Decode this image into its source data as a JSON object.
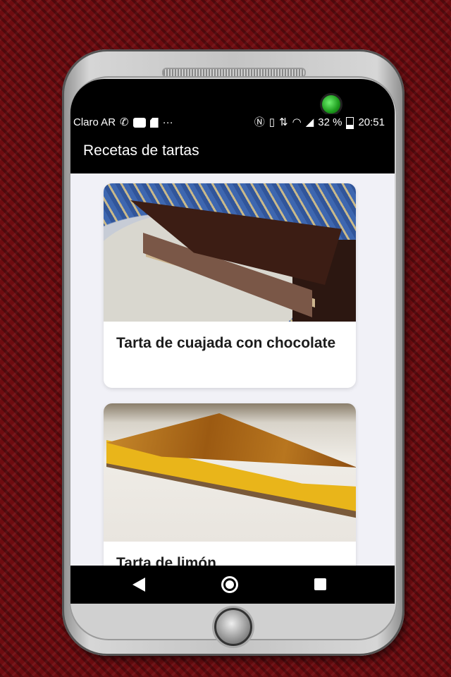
{
  "status_bar": {
    "carrier": "Claro AR",
    "dots": "···",
    "battery": "32 %",
    "time": "20:51",
    "icons": [
      "whatsapp-icon",
      "notification-square-icon",
      "sd-card-icon",
      "nfc-icon",
      "vibrate-icon",
      "data-arrows-icon",
      "wifi-icon",
      "signal-icon",
      "battery-icon"
    ]
  },
  "app_bar": {
    "title": "Recetas de tartas"
  },
  "recipes": [
    {
      "title": "Tarta de cuajada con chocolate",
      "image": "chocolate-cheesecake-photo"
    },
    {
      "title": "Tarta de limón",
      "image": "lemon-tart-photo"
    }
  ],
  "nav_bar": {
    "icons": [
      "back-icon",
      "home-icon",
      "recents-icon"
    ]
  },
  "colors": {
    "background": "#6e0c10",
    "app_bar": "#000000",
    "content_bg": "#f1f1f7",
    "card": "#ffffff"
  }
}
